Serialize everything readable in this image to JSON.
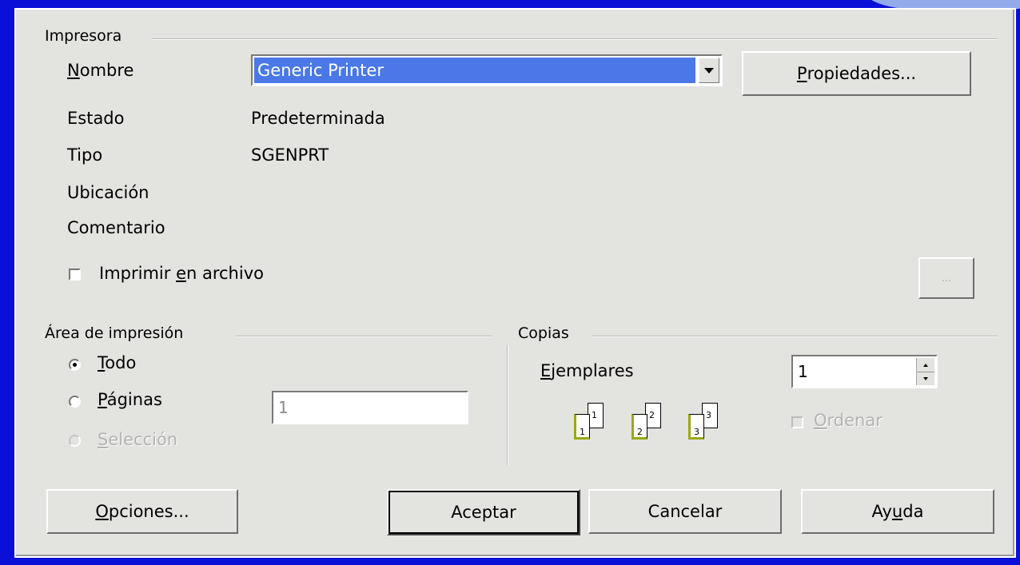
{
  "printer": {
    "group_label": "Impresora",
    "name_label_first": "N",
    "name_label_rest": "ombre",
    "selected": "Generic Printer",
    "properties_btn_first": "P",
    "properties_btn_rest": "ropiedades...",
    "status_label": "Estado",
    "status_value": "Predeterminada",
    "type_label": "Tipo",
    "type_value": "SGENPRT",
    "location_label": "Ubicación",
    "comment_label": "Comentario",
    "print_to_file_pre": "Imprimir ",
    "print_to_file_u": "e",
    "print_to_file_post": "n archivo",
    "print_to_file_checked": false,
    "browse_btn": "..."
  },
  "print_range": {
    "group_label": "Área de impresión",
    "all_first": "T",
    "all_rest": "odo",
    "pages_first": "P",
    "pages_rest": "áginas",
    "selection_first": "S",
    "selection_rest": "elección",
    "selected": "Todo",
    "pages_value": "1"
  },
  "copies": {
    "group_label": "Copias",
    "count_label_first": "E",
    "count_label_rest": "jemplares",
    "count_value": "1",
    "collate_first": "O",
    "collate_rest": "rdenar",
    "collate_checked": false
  },
  "collate_icon": {
    "pages": [
      "1",
      "2",
      "3"
    ]
  },
  "buttons": {
    "options_first": "O",
    "options_rest": "pciones...",
    "ok": "Aceptar",
    "cancel": "Cancelar",
    "help_pre": "Ay",
    "help_u": "u",
    "help_post": "da"
  },
  "colors": {
    "background": "#0a10d8",
    "dialog": "#e3e3e0",
    "selection": "#4a78e8"
  }
}
